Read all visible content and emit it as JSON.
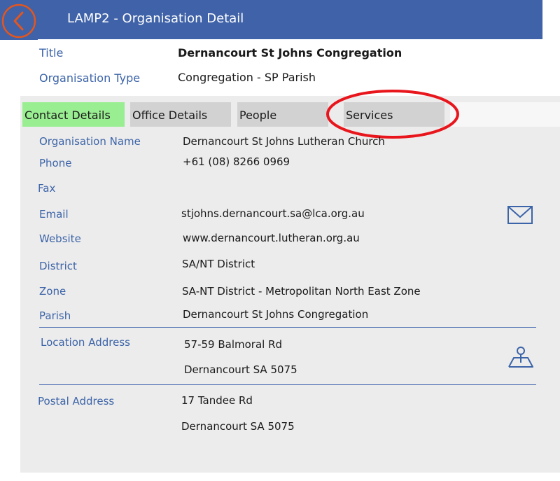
{
  "header": {
    "title": "LAMP2 - Organisation Detail",
    "back_icon": "chevron-left-icon"
  },
  "summary": {
    "title_label": "Title",
    "title_value": "Dernancourt St Johns Congregation",
    "type_label": "Organisation Type",
    "type_value": "Congregation - SP Parish"
  },
  "tabs": [
    {
      "label": "Contact Details",
      "selected": true
    },
    {
      "label": "Office Details",
      "selected": false
    },
    {
      "label": "People",
      "selected": false
    },
    {
      "label": "Services",
      "selected": false
    }
  ],
  "contact": {
    "org_name_label": "Organisation Name",
    "org_name_value": "Dernancourt St Johns Lutheran Church",
    "phone_label": "Phone",
    "phone_value": "+61 (08) 8266 0969",
    "fax_label": "Fax",
    "fax_value": "",
    "email_label": "Email",
    "email_value": "stjohns.dernancourt.sa@lca.org.au",
    "website_label": "Website",
    "website_value": "www.dernancourt.lutheran.org.au",
    "district_label": "District",
    "district_value": "SA/NT District",
    "zone_label": "Zone",
    "zone_value": "SA-NT District - Metropolitan North East Zone",
    "parish_label": "Parish",
    "parish_value": "Dernancourt St Johns Congregation",
    "location_label": "Location Address",
    "location_line1": "57-59 Balmoral Rd",
    "location_line2": "Dernancourt SA 5075",
    "postal_label": "Postal Address",
    "postal_line1": "17 Tandee Rd",
    "postal_line2": "Dernancourt SA 5075"
  },
  "icons": {
    "email": "envelope-icon",
    "map": "map-location-icon"
  },
  "colors": {
    "header_bg": "#3f62a8",
    "selected_tab": "#9aee92",
    "label_blue": "#3c64a8",
    "annotation_red": "#e8161c",
    "back_ring": "#e2561f"
  }
}
